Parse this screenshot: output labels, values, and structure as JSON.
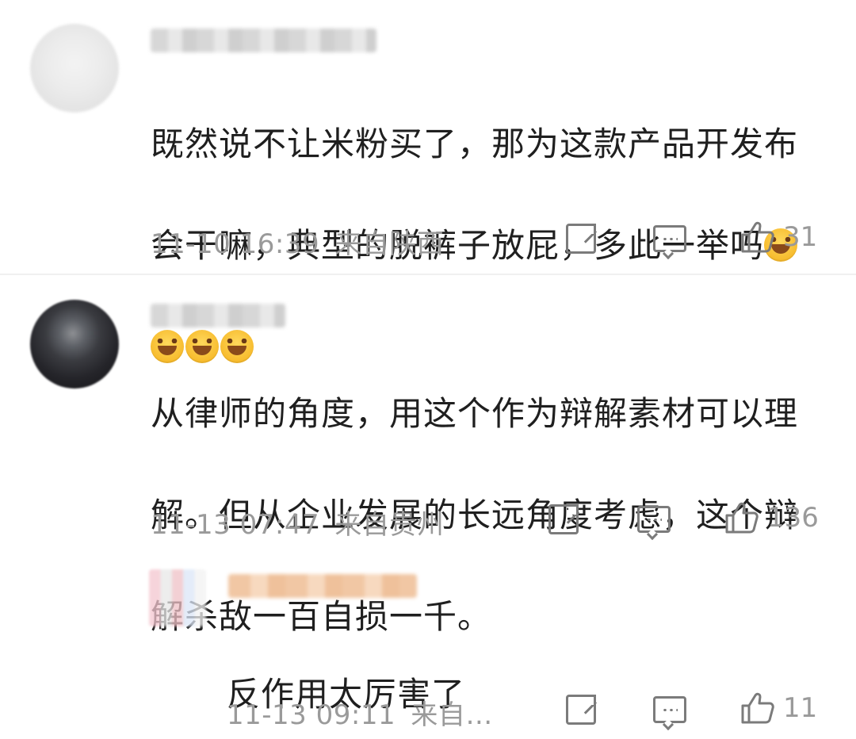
{
  "comments": [
    {
      "avatar": "blurred",
      "username": "",
      "text_lines": [
        "既然说不让米粉买了，那为这款产品开发布",
        "会干嘛，典型的脱裤子放屁，多此一举吗"
      ],
      "emoji": "laugh-cry-emoji",
      "emoji_count": 4,
      "timestamp": "11-10 16:39",
      "location": "来自陕西",
      "likes": "31"
    },
    {
      "avatar": "blurred-dark",
      "username": "",
      "text_lines": [
        "从律师的角度，用这个作为辩解素材可以理",
        "解。但从企业发展的长远角度考虑，这个辩",
        "解杀敌一百自损一千。"
      ],
      "timestamp": "11-13 07:47",
      "location": "来自贵州",
      "likes": "136"
    }
  ],
  "reply": {
    "avatar": "blurred-multi",
    "username": "",
    "text": "反作用太厉害了",
    "timestamp": "11-13 09:11",
    "location": "来自…",
    "likes": "11"
  },
  "icons": {
    "share": "share-icon",
    "comment": "comment-icon",
    "like": "thumbs-up-icon"
  },
  "colors": {
    "text_primary": "#1f1f1f",
    "text_meta": "#9a9a9a",
    "icon": "#7b7b7b"
  }
}
